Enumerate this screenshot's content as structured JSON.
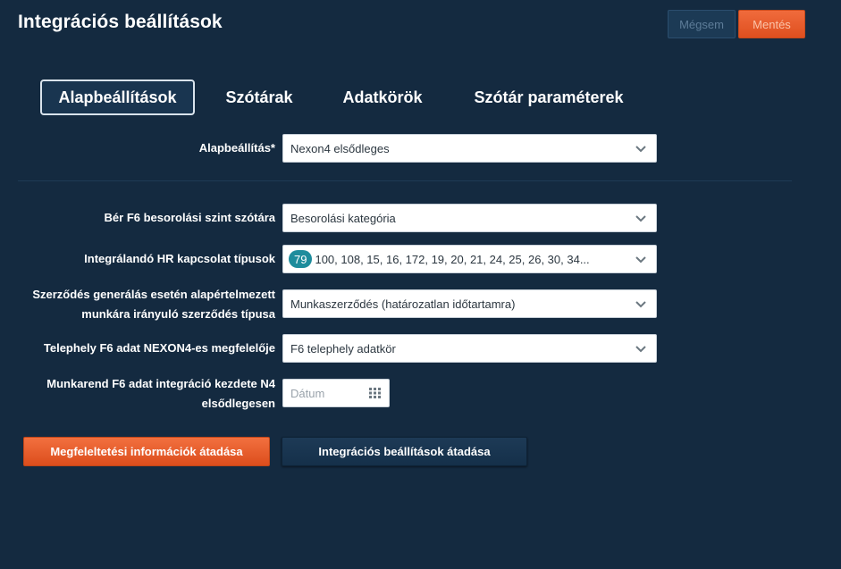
{
  "header": {
    "title": "Integrációs beállítások",
    "cancel_label": "Mégsem",
    "save_label": "Mentés"
  },
  "tabs": [
    {
      "label": "Alapbeállítások",
      "active": true
    },
    {
      "label": "Szótárak",
      "active": false
    },
    {
      "label": "Adatkörök",
      "active": false
    },
    {
      "label": "Szótár paraméterek",
      "active": false
    }
  ],
  "form": {
    "base": {
      "label": "Alapbeállítás*",
      "value": "Nexon4 elsődleges"
    },
    "classification": {
      "label": "Bér F6 besorolási szint szótára",
      "value": "Besorolási kategória"
    },
    "hr_types": {
      "label": "Integrálandó HR kapcsolat típusok",
      "badge": "79",
      "value": "100, 108, 15, 16, 172, 19, 20, 21, 24, 25, 26, 30, 34..."
    },
    "contract": {
      "label_line1": "Szerződés generálás esetén alapértelmezett",
      "label_line2": "munkára irányuló szerződés típusa",
      "value": "Munkaszerződés (határozatlan időtartamra)"
    },
    "site": {
      "label": "Telephely F6 adat NEXON4-es megfelelője",
      "value": "F6 telephely adatkör"
    },
    "schedule": {
      "label_line1": "Munkarend F6 adat integráció kezdete N4",
      "label_line2": "elsődlegesen",
      "placeholder": "Dátum"
    }
  },
  "actions": {
    "transfer_mapping": "Megfeleltetési információk átadása",
    "transfer_settings": "Integrációs beállítások átadása"
  },
  "colors": {
    "background": "#142a40",
    "accent_orange": "#e55a28",
    "badge_teal": "#1e8c9c"
  }
}
